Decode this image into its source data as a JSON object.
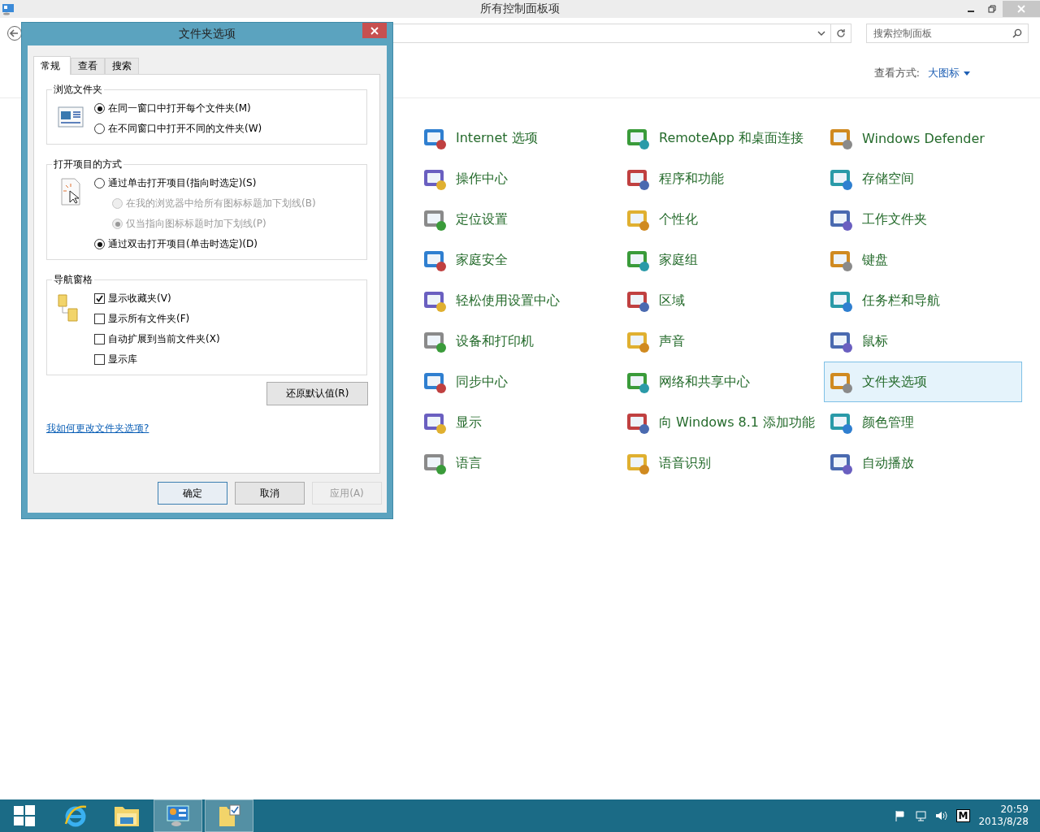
{
  "window": {
    "title": "所有控制面板项"
  },
  "search": {
    "placeholder": "搜索控制面板"
  },
  "view": {
    "label": "查看方式:",
    "value": "大图标"
  },
  "items": [
    {
      "label": "Internet 选项",
      "selected": false
    },
    {
      "label": "RemoteApp 和桌面连接",
      "selected": false
    },
    {
      "label": "Windows Defender",
      "selected": false
    },
    {
      "label": "操作中心",
      "selected": false
    },
    {
      "label": "程序和功能",
      "selected": false
    },
    {
      "label": "存储空间",
      "selected": false
    },
    {
      "label": "定位设置",
      "selected": false
    },
    {
      "label": "个性化",
      "selected": false
    },
    {
      "label": "工作文件夹",
      "selected": false
    },
    {
      "label": "家庭安全",
      "selected": false
    },
    {
      "label": "家庭组",
      "selected": false
    },
    {
      "label": "键盘",
      "selected": false
    },
    {
      "label": "轻松使用设置中心",
      "selected": false
    },
    {
      "label": "区域",
      "selected": false
    },
    {
      "label": "任务栏和导航",
      "selected": false
    },
    {
      "label": "设备和打印机",
      "selected": false
    },
    {
      "label": "声音",
      "selected": false
    },
    {
      "label": "鼠标",
      "selected": false
    },
    {
      "label": "同步中心",
      "selected": false
    },
    {
      "label": "网络和共享中心",
      "selected": false
    },
    {
      "label": "文件夹选项",
      "selected": true
    },
    {
      "label": "显示",
      "selected": false
    },
    {
      "label": "向 Windows 8.1 添加功能",
      "selected": false
    },
    {
      "label": "颜色管理",
      "selected": false
    },
    {
      "label": "语言",
      "selected": false
    },
    {
      "label": "语音识别",
      "selected": false
    },
    {
      "label": "自动播放",
      "selected": false
    }
  ],
  "dialog": {
    "title": "文件夹选项",
    "tabs": [
      {
        "label": "常规",
        "selected": true
      },
      {
        "label": "查看",
        "selected": false
      },
      {
        "label": "搜索",
        "selected": false
      }
    ],
    "groups": [
      {
        "title": "浏览文件夹",
        "kind": "window",
        "options": [
          {
            "kind": "radio",
            "label": "在同一窗口中打开每个文件夹(M)",
            "checked": true,
            "disabled": false
          },
          {
            "kind": "radio",
            "label": "在不同窗口中打开不同的文件夹(W)",
            "checked": false,
            "disabled": false
          }
        ]
      },
      {
        "title": "打开项目的方式",
        "kind": "click",
        "options": [
          {
            "kind": "radio",
            "label": "通过单击打开项目(指向时选定)(S)",
            "checked": false,
            "disabled": false,
            "children": [
              {
                "kind": "radio",
                "label": "在我的浏览器中给所有图标标题加下划线(B)",
                "checked": false,
                "disabled": true
              },
              {
                "kind": "radio",
                "label": "仅当指向图标标题时加下划线(P)",
                "checked": true,
                "disabled": true
              }
            ]
          },
          {
            "kind": "radio",
            "label": "通过双击打开项目(单击时选定)(D)",
            "checked": true,
            "disabled": false
          }
        ]
      },
      {
        "title": "导航窗格",
        "kind": "folders",
        "options": [
          {
            "kind": "checkbox",
            "label": "显示收藏夹(V)",
            "checked": true,
            "disabled": false
          },
          {
            "kind": "checkbox",
            "label": "显示所有文件夹(F)",
            "checked": false,
            "disabled": false
          },
          {
            "kind": "checkbox",
            "label": "自动扩展到当前文件夹(X)",
            "checked": false,
            "disabled": false
          },
          {
            "kind": "checkbox",
            "label": "显示库",
            "checked": false,
            "disabled": false
          }
        ]
      }
    ],
    "restore_button": "还原默认值(R)",
    "help_link": "我如何更改文件夹选项?",
    "buttons": [
      {
        "label": "确定",
        "default": true,
        "disabled": false
      },
      {
        "label": "取消",
        "default": false,
        "disabled": false
      },
      {
        "label": "应用(A)",
        "default": false,
        "disabled": true
      }
    ]
  },
  "taskbar": {
    "apps": [
      {
        "selected": false
      },
      {
        "selected": false
      },
      {
        "selected": false
      },
      {
        "selected": true
      },
      {
        "selected": true
      }
    ],
    "tray": {
      "ime": "M",
      "time": "20:59",
      "date": "2013/8/28"
    }
  }
}
